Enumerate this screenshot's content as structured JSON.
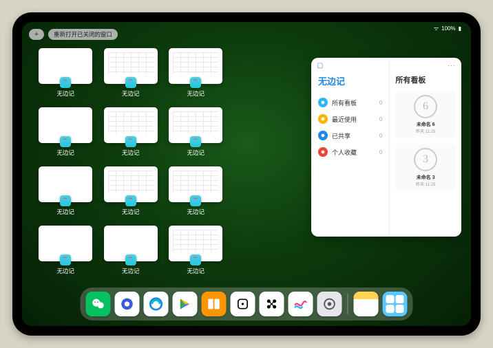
{
  "status": {
    "battery": "100%"
  },
  "topbar": {
    "plus": "+",
    "reopen": "重新打开已关闭的窗口"
  },
  "app_switcher": {
    "app_name": "无边记",
    "windows": [
      {
        "label": "无边记",
        "variant": "blank"
      },
      {
        "label": "无边记",
        "variant": "cal"
      },
      {
        "label": "无边记",
        "variant": "cal"
      },
      {
        "label": "",
        "variant": "empty"
      },
      {
        "label": "无边记",
        "variant": "blank"
      },
      {
        "label": "无边记",
        "variant": "cal"
      },
      {
        "label": "无边记",
        "variant": "cal"
      },
      {
        "label": "",
        "variant": "empty"
      },
      {
        "label": "无边记",
        "variant": "blank"
      },
      {
        "label": "无边记",
        "variant": "cal"
      },
      {
        "label": "无边记",
        "variant": "cal"
      },
      {
        "label": "",
        "variant": "empty"
      },
      {
        "label": "无边记",
        "variant": "blank"
      },
      {
        "label": "无边记",
        "variant": "blank"
      },
      {
        "label": "无边记",
        "variant": "cal"
      }
    ]
  },
  "panel": {
    "icon": "▢",
    "more": "···",
    "left_title": "无边记",
    "items": [
      {
        "label": "所有看板",
        "count": "0",
        "color": "#29b6f6"
      },
      {
        "label": "最近使用",
        "count": "0",
        "color": "#ffb300"
      },
      {
        "label": "已共享",
        "count": "0",
        "color": "#1e88e5"
      },
      {
        "label": "个人收藏",
        "count": "0",
        "color": "#f44336"
      }
    ],
    "right_title": "所有看板",
    "boards": [
      {
        "glyph": "6",
        "name": "未命名 6",
        "sub": "昨天 11:25"
      },
      {
        "glyph": "3",
        "name": "未命名 3",
        "sub": "昨天 11:25"
      }
    ]
  },
  "dock": {
    "apps": [
      {
        "name": "wechat",
        "bg": "#07c160"
      },
      {
        "name": "quark",
        "bg": "#ffffff"
      },
      {
        "name": "qqbrowser",
        "bg": "#ffffff"
      },
      {
        "name": "play",
        "bg": "#ffffff"
      },
      {
        "name": "books",
        "bg": "#ff9500"
      },
      {
        "name": "dice",
        "bg": "#ffffff"
      },
      {
        "name": "connect",
        "bg": "#ffffff"
      },
      {
        "name": "freeform",
        "bg": "#ffffff"
      },
      {
        "name": "settings",
        "bg": "#e5e5ea"
      },
      {
        "name": "notes",
        "bg": "#ffffff"
      },
      {
        "name": "app-library",
        "bg": "#5ac8fa"
      }
    ]
  }
}
